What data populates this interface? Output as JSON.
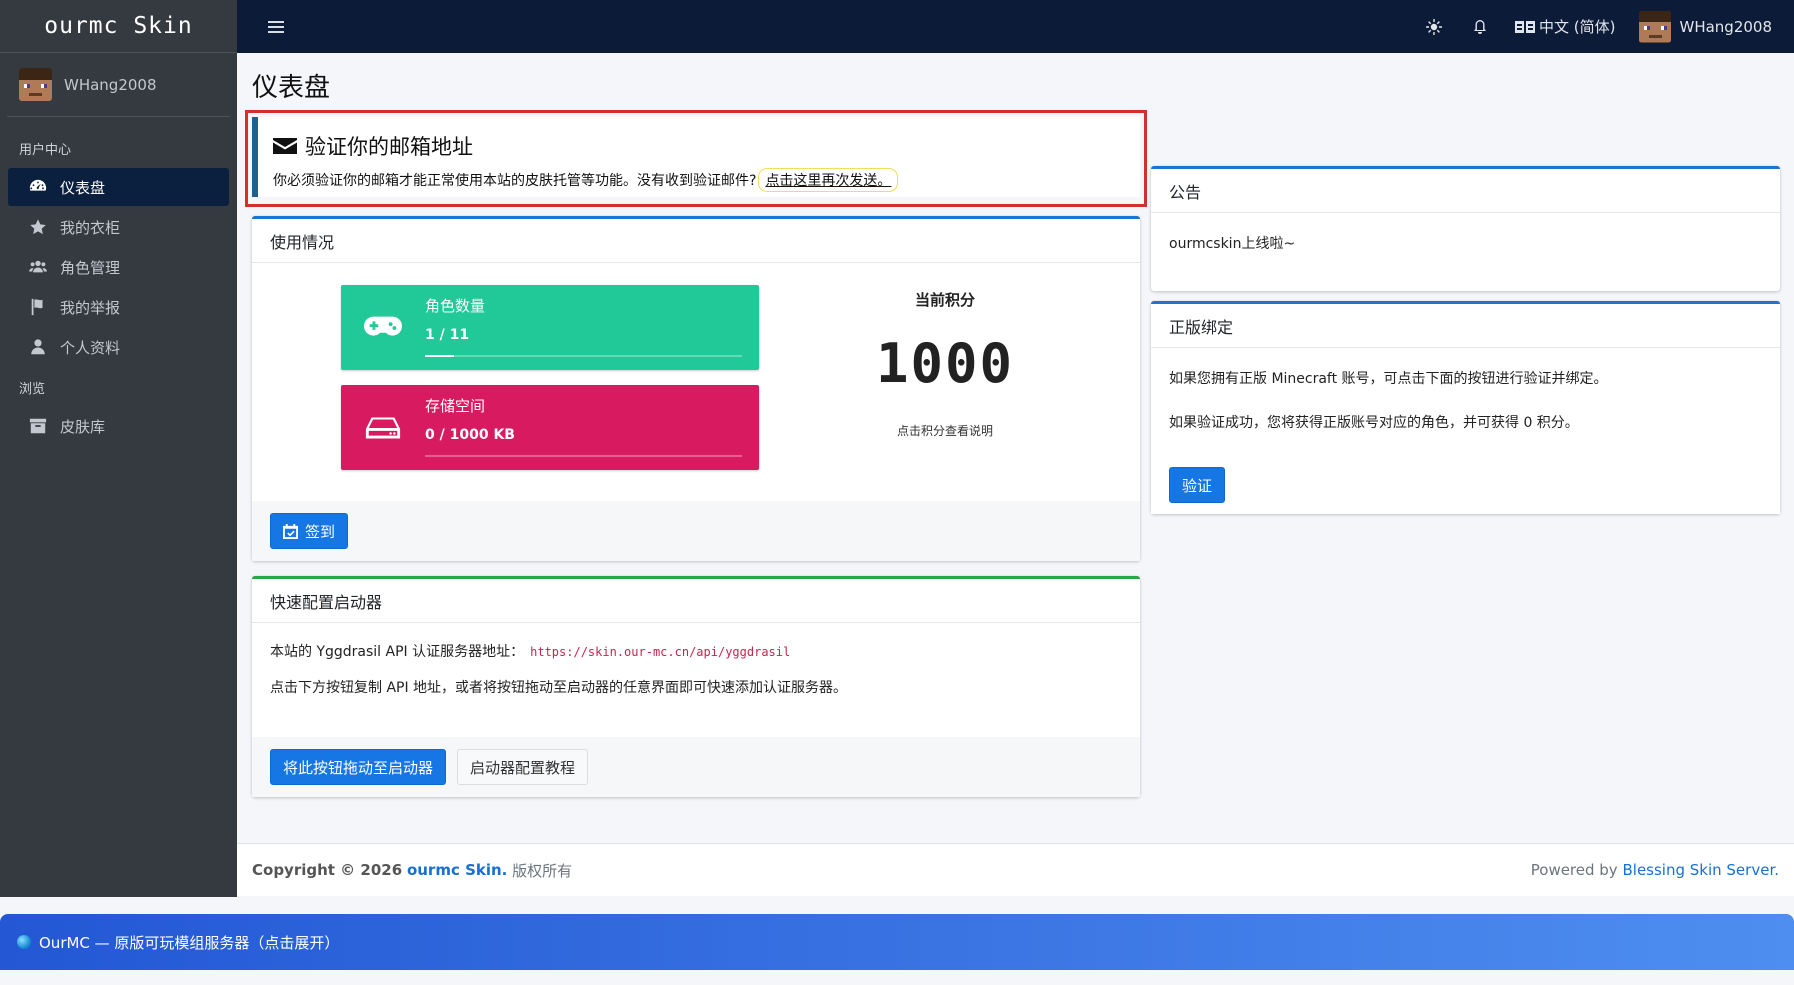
{
  "brand": "ourmc Skin",
  "user": {
    "name": "WHang2008"
  },
  "sidebar": {
    "header_user_center": "用户中心",
    "items": [
      {
        "label": "仪表盘",
        "icon": "dashboard-icon"
      },
      {
        "label": "我的衣柜",
        "icon": "star-icon"
      },
      {
        "label": "角色管理",
        "icon": "users-icon"
      },
      {
        "label": "我的举报",
        "icon": "flag-icon"
      },
      {
        "label": "个人资料",
        "icon": "user-icon"
      }
    ],
    "header_browse": "浏览",
    "browse_items": [
      {
        "label": "皮肤库",
        "icon": "archive-icon"
      }
    ]
  },
  "topbar": {
    "language": "中文 (简体)"
  },
  "page": {
    "title": "仪表盘"
  },
  "alert": {
    "title": "验证你的邮箱地址",
    "text": "你必须验证你的邮箱才能正常使用本站的皮肤托管等功能。没有收到验证邮件?",
    "resend_link": "点击这里再次发送。"
  },
  "usage": {
    "title": "使用情况",
    "players": {
      "label": "角色数量",
      "value": "1 / 11",
      "fraction": 0.0909
    },
    "storage": {
      "label": "存储空间",
      "value": "0 / 1000 KB",
      "fraction": 0
    },
    "score_title": "当前积分",
    "score_value": "1000",
    "score_hint": "点击积分查看说明",
    "checkin_label": "签到"
  },
  "launcher": {
    "title": "快速配置启动器",
    "api_text": "本站的 Yggdrasil API 认证服务器地址：",
    "api_url": "https://skin.our-mc.cn/api/yggdrasil",
    "hint": "点击下方按钮复制 API 地址，或者将按钮拖动至启动器的任意界面即可快速添加认证服务器。",
    "drag_button": "将此按钮拖动至启动器",
    "tutorial_button": "启动器配置教程"
  },
  "notice": {
    "title": "公告",
    "text": "ourmcskin上线啦~"
  },
  "genuine": {
    "title": "正版绑定",
    "line1": "如果您拥有正版 Minecraft 账号，可点击下面的按钮进行验证并绑定。",
    "line2": "如果验证成功，您将获得正版账号对应的角色，并可获得 0 积分。",
    "verify_button": "验证"
  },
  "footer": {
    "copyright_prefix": "Copyright © 2026",
    "site": "ourmc Skin.",
    "rights": "版权所有",
    "powered_prefix": "Powered by",
    "powered_link": "Blessing Skin Server."
  },
  "promo": {
    "text": "OurMC — 原版可玩模组服务器（点击展开）"
  },
  "colors": {
    "sidebar": "#343a40",
    "topbar": "#0c1c38",
    "primary": "#1677e4",
    "green": "#20c997",
    "red": "#d81b60",
    "alert_border": "#d32f2f"
  }
}
